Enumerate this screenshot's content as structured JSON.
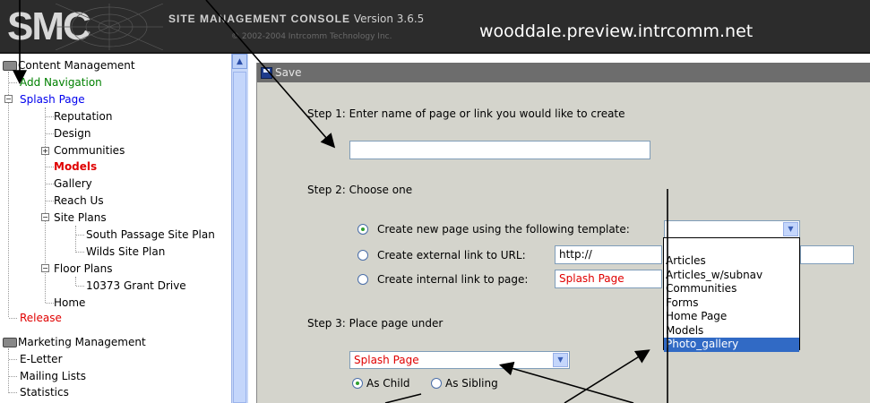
{
  "header": {
    "logo": "SMC",
    "console_name": "SITE MANAGEMENT CONSOLE",
    "version": "Version 3.6.5",
    "copyright": "© 2002-2004 Intrcomm Technology Inc.",
    "site_url": "wooddale.preview.intrcomm.net"
  },
  "sidebar": {
    "content_management": "Content Management",
    "add_navigation": "Add Navigation",
    "splash_page": "Splash Page",
    "reputation": "Reputation",
    "design": "Design",
    "communities": "Communities",
    "models": "Models",
    "gallery": "Gallery",
    "reach_us": "Reach Us",
    "site_plans": "Site Plans",
    "south_passage": "South Passage Site Plan",
    "wilds": "Wilds Site Plan",
    "floor_plans": "Floor Plans",
    "grant_drive": "10373 Grant Drive",
    "home": "Home",
    "release": "Release",
    "marketing_management": "Marketing Management",
    "eletter": "E-Letter",
    "mailing_lists": "Mailing Lists",
    "statistics": "Statistics"
  },
  "main": {
    "save_label": "Save",
    "step1": "Step 1: Enter name of page or link you would like to create",
    "page_name_value": "",
    "step2": "Step 2: Choose one",
    "opt_template": "Create new page using the following template:",
    "opt_external": "Create external link to URL:",
    "external_url_value": "http://",
    "opt_internal": "Create internal link to page:",
    "internal_page_value": "Splash Page",
    "template_selected": "",
    "template_options": [
      "Articles",
      "Articles_w/subnav",
      "Communities",
      "Forms",
      "Home Page",
      "Models",
      "Photo_gallery"
    ],
    "template_highlighted": "Photo_gallery",
    "step3": "Step 3: Place page under",
    "parent_page_value": "Splash Page",
    "as_child": "As Child",
    "as_sibling": "As Sibling"
  },
  "colors": {
    "header_bg": "#2c2c2c",
    "panel_bg": "#d4d4cc",
    "save_bar": "#6d6d6d",
    "highlight": "#316ac5",
    "link_green": "#008000",
    "link_blue": "#0000ee",
    "link_red": "#e00000"
  }
}
